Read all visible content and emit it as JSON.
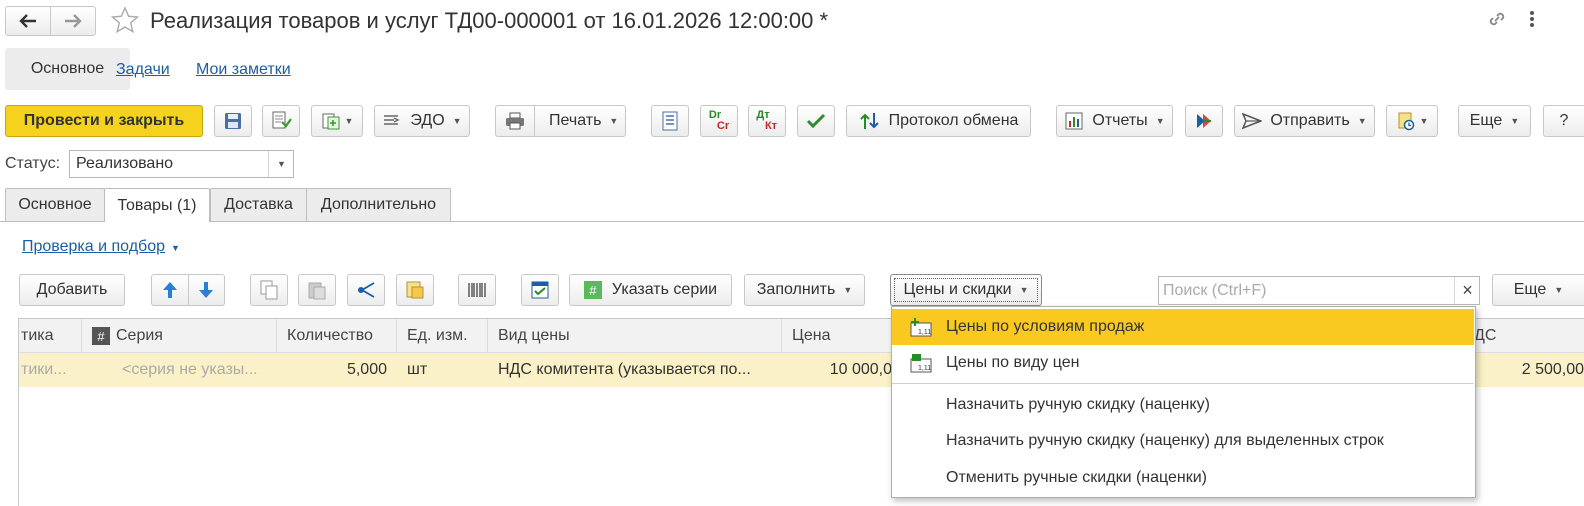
{
  "window": {
    "title": "Реализация товаров и услуг ТД00-000001 от 16.01.2026 12:00:00 *"
  },
  "nav": {
    "back_icon": "arrow-left-icon",
    "forward_icon": "arrow-right-icon",
    "star_icon": "star-icon",
    "link_icon": "link-icon",
    "more_icon": "kebab-icon"
  },
  "top_tabs": [
    {
      "label": "Основное"
    },
    {
      "label": "Задачи"
    },
    {
      "label": "Мои заметки"
    }
  ],
  "toolbar": {
    "post_close": "Провести и закрыть",
    "edo": "ЭДО",
    "print": "Печать",
    "protocol": "Протокол обмена",
    "reports": "Отчеты",
    "send": "Отправить",
    "more": "Еще",
    "help": "?",
    "dr": "Dr",
    "cr": "Cr",
    "dt": "Дт",
    "kt": "Кт"
  },
  "status": {
    "label": "Статус:",
    "value": "Реализовано"
  },
  "tabs": [
    {
      "label": "Основное"
    },
    {
      "label": "Товары (1)"
    },
    {
      "label": "Доставка"
    },
    {
      "label": "Дополнительно"
    }
  ],
  "goods": {
    "check_link": "Проверка и подбор",
    "add": "Добавить",
    "specify_series": "Указать серии",
    "fill": "Заполнить",
    "prices_discounts": "Цены и скидки",
    "search_placeholder": "Поиск (Ctrl+F)",
    "clear": "×",
    "more": "Еще"
  },
  "table": {
    "headers": [
      "тика",
      "Серия",
      "Количество",
      "Ед. изм.",
      "Вид цены",
      "Цена",
      "ДС"
    ],
    "row": {
      "characteristic": "тики...",
      "series": "<серия не указы...",
      "quantity": "5,000",
      "unit": "шт",
      "price_type": "НДС комитента (указывается по...",
      "price": "10 000,0",
      "vat": "2 500,00"
    }
  },
  "menu": {
    "items": [
      {
        "label": "Цены по условиям продаж",
        "highlighted": true
      },
      {
        "label": "Цены по виду цен"
      },
      {
        "label": "Назначить ручную скидку (наценку)"
      },
      {
        "label": "Назначить ручную скидку (наценку) для выделенных строк"
      },
      {
        "label": "Отменить ручные скидки (наценки)"
      }
    ]
  },
  "colors": {
    "accent_yellow": "#f5d21c",
    "highlight": "#f9c91f",
    "row_bg": "#fbf1c8",
    "link": "#1a5ea8"
  }
}
